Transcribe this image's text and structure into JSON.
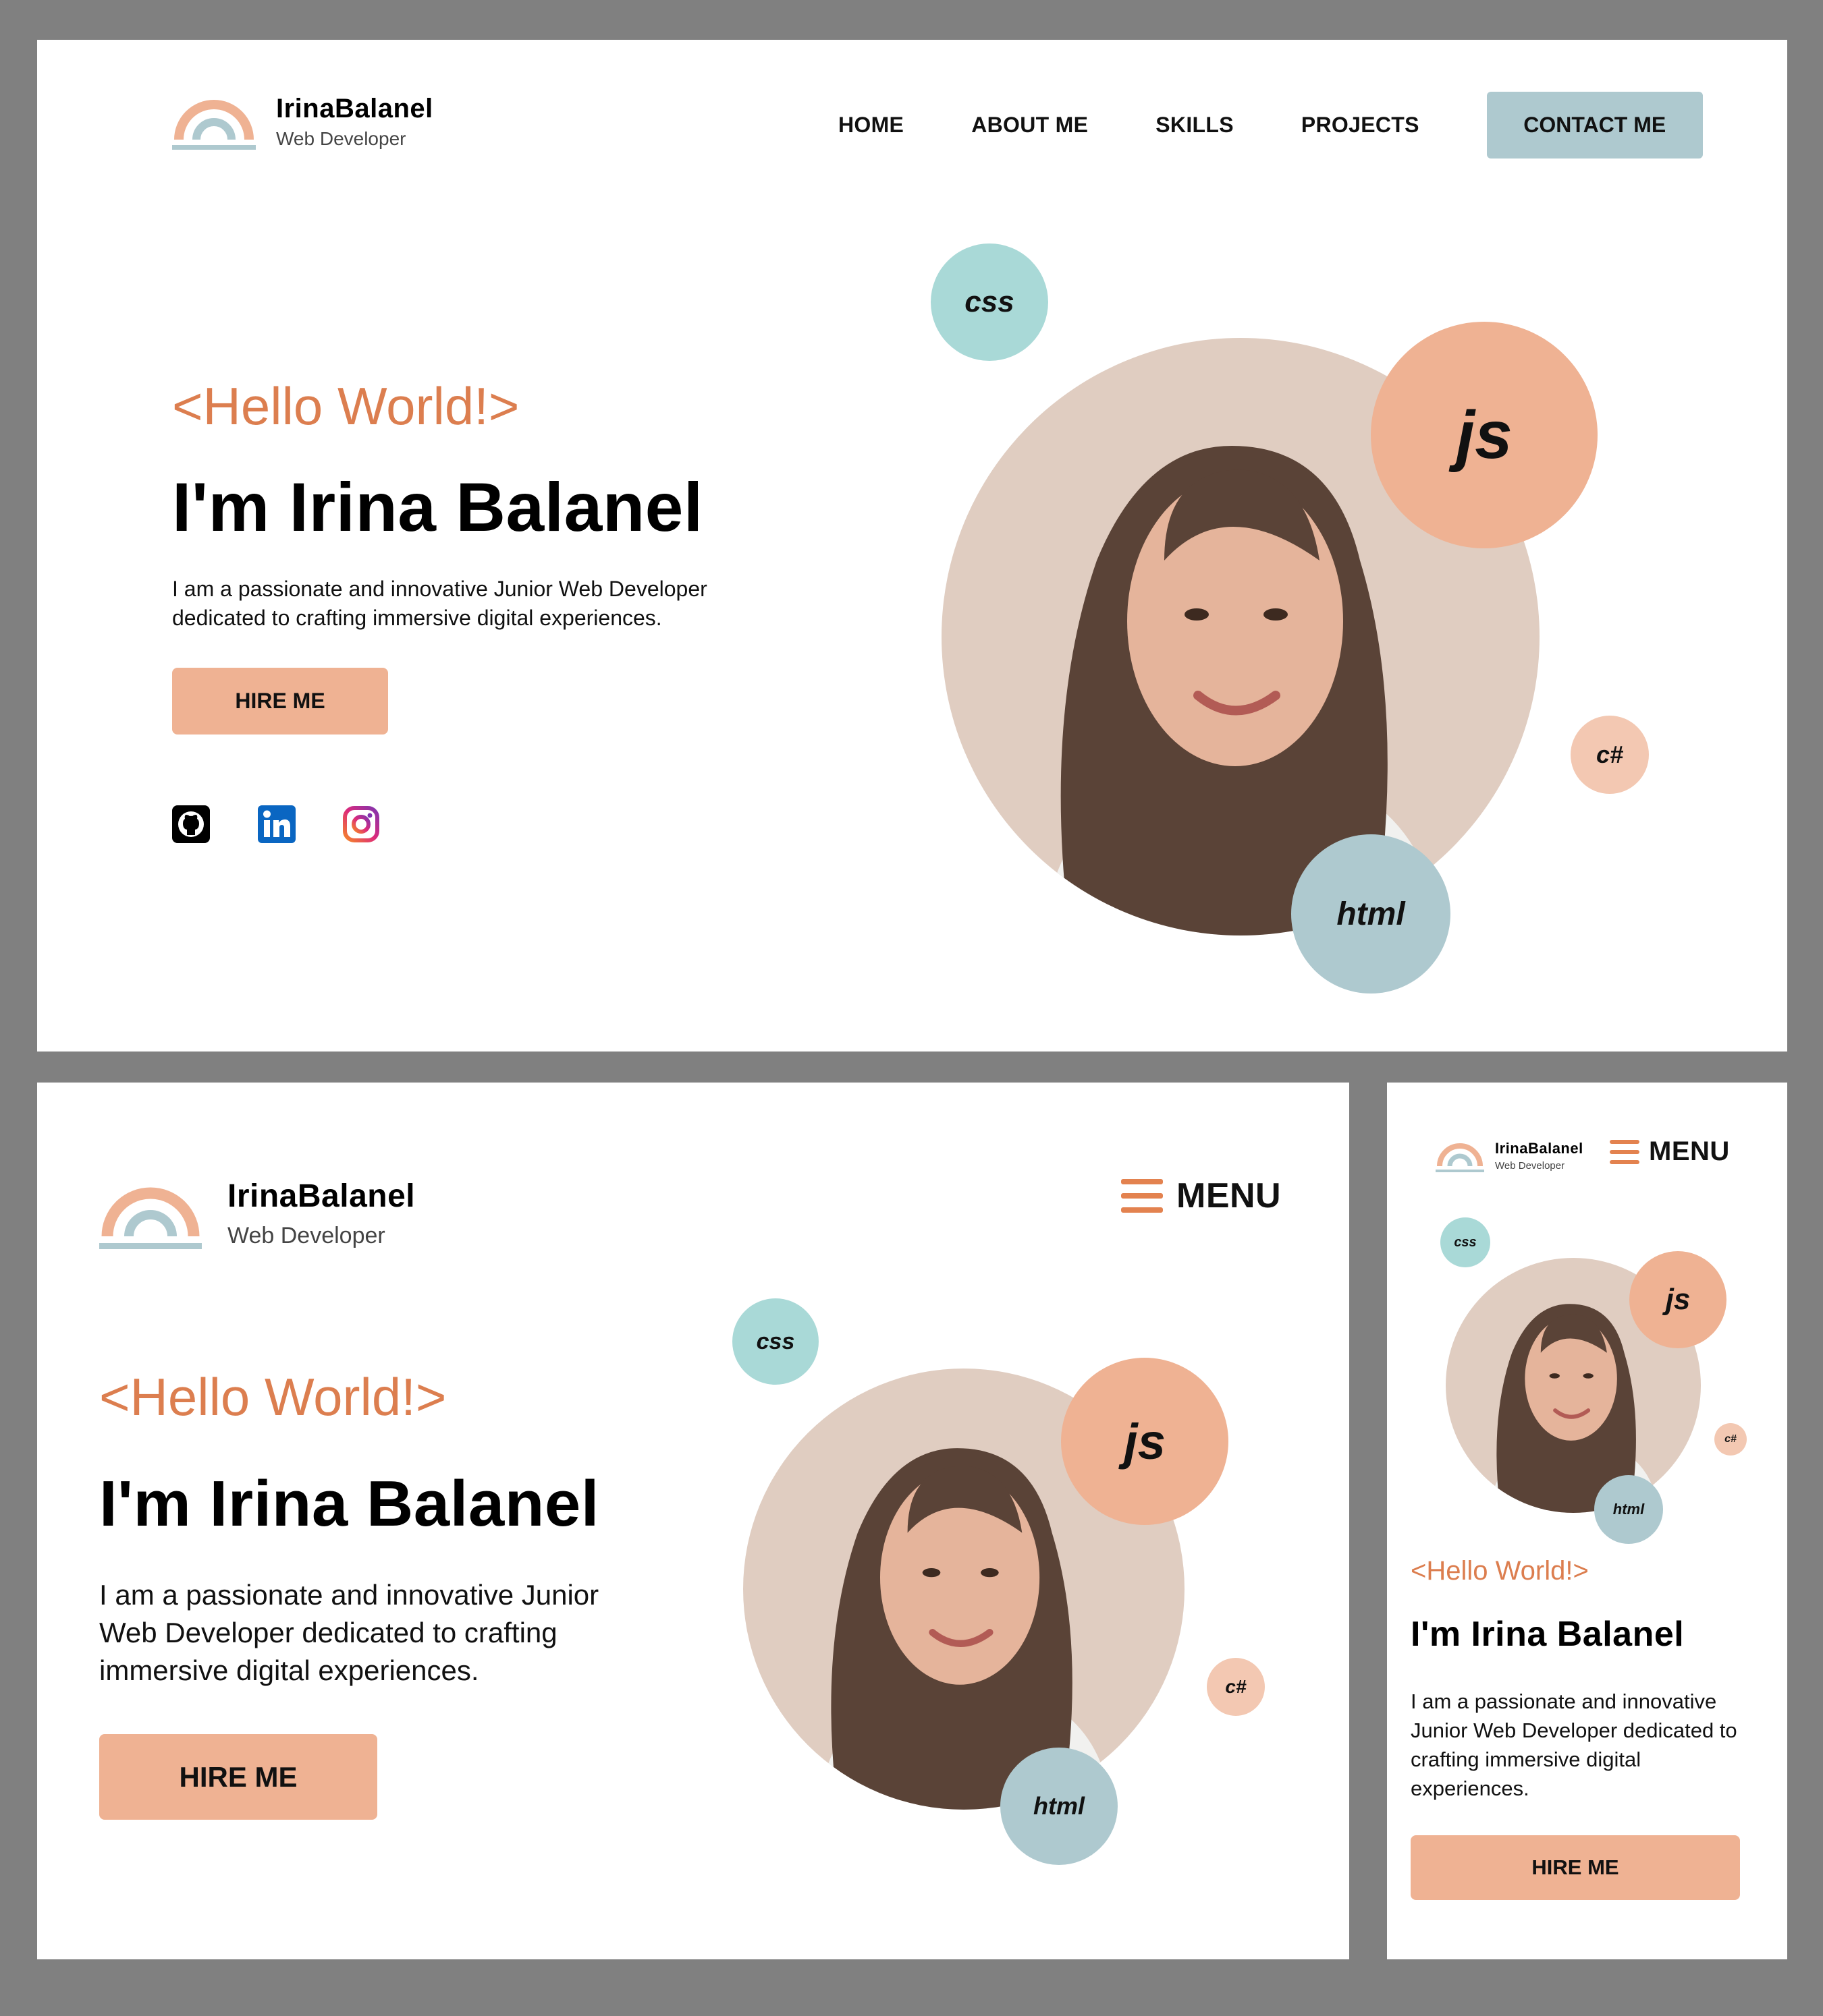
{
  "brand": {
    "name": "IrinaBalanel",
    "subtitle": "Web Developer"
  },
  "nav": {
    "items": [
      "HOME",
      "ABOUT ME",
      "SKILLS",
      "PROJECTS"
    ],
    "contact_label": "CONTACT ME"
  },
  "menu": {
    "label": "MENU"
  },
  "hero": {
    "greeting": "<Hello World!>",
    "title": "I'm Irina Balanel",
    "description": "I am a passionate and innovative Junior Web Developer dedicated to crafting immersive digital experiences.",
    "hire_label": "HIRE ME"
  },
  "skills": {
    "css": "css",
    "js": "js",
    "csharp": "c#",
    "html": "html"
  },
  "social_icons": [
    "github-icon",
    "linkedin-icon",
    "instagram-icon"
  ],
  "colors": {
    "accent_orange": "#dc7e4f",
    "button_peach": "#efb293",
    "contact_blue": "#aec9cf",
    "bubble_teal": "#a9d9d7",
    "portrait_bg": "#e0cdc1",
    "backdrop_gray": "#808080"
  }
}
